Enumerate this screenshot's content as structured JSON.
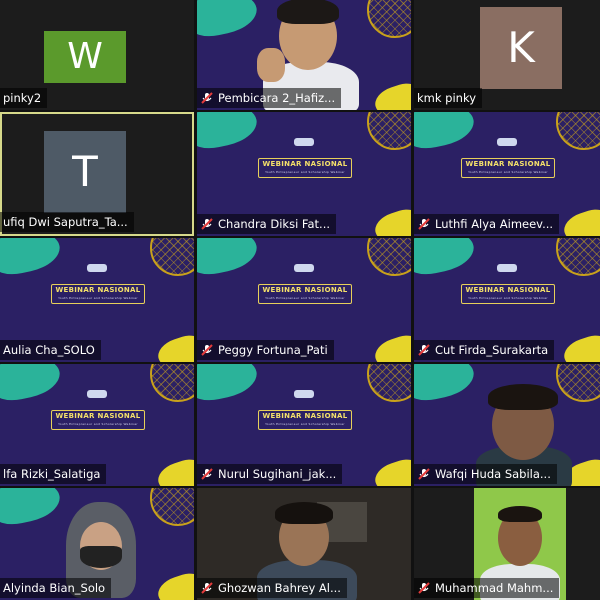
{
  "tiles": [
    {
      "name": "pinky2",
      "avatar_letter": "W",
      "avatar_color": "#5b9a2c",
      "muted": false
    },
    {
      "name": "Pembicara 2_Hafiz...",
      "muted": true
    },
    {
      "name": "kmk pinky",
      "avatar_letter": "K",
      "avatar_color": "#8a6e62",
      "muted": false
    },
    {
      "name": "ufiq Dwi Saputra_Ta...",
      "avatar_letter": "T",
      "avatar_color": "#4e5a66",
      "muted": false
    },
    {
      "name": "Chandra Diksi Fat...",
      "muted": true
    },
    {
      "name": "Luthfi Alya Aimeev...",
      "muted": true
    },
    {
      "name": "Aulia Cha_SOLO",
      "muted": false
    },
    {
      "name": "Peggy Fortuna_Pati",
      "muted": true
    },
    {
      "name": "Cut Firda_Surakarta",
      "muted": true
    },
    {
      "name": "lfa Rizki_Salatiga",
      "muted": false
    },
    {
      "name": "Nurul Sugihani_jak...",
      "muted": true
    },
    {
      "name": "Wafqi Huda Sabila...",
      "muted": true
    },
    {
      "name": "Alyinda Bian_Solo",
      "muted": false
    },
    {
      "name": "Ghozwan Bahrey Al...",
      "muted": true
    },
    {
      "name": "Muhammad Mahm...",
      "muted": true
    }
  ],
  "slide": {
    "title": "WEBINAR NASIONAL",
    "subtitle": "Youth Entrepreneur and Scholarship Webinar"
  },
  "colors": {
    "highlight": "#d6d98a",
    "muted_icon": "#e23b3b",
    "slide_bg": "#2b2064"
  }
}
